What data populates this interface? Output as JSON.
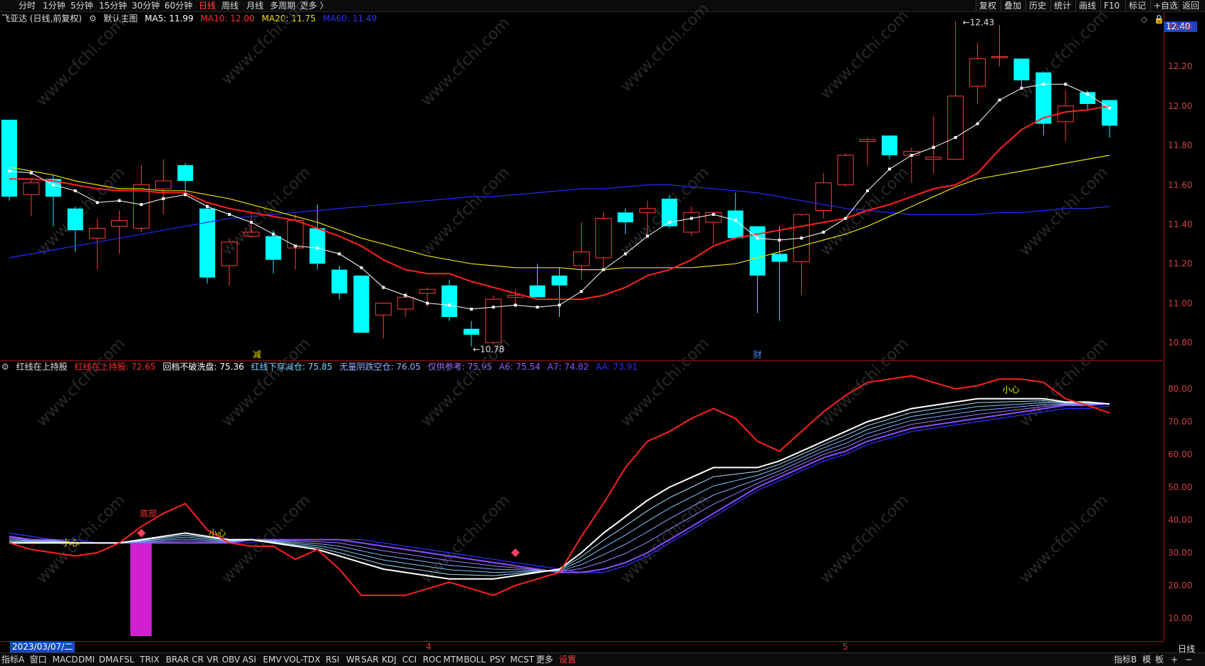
{
  "period_tabs": [
    "分时",
    "1分钟",
    "5分钟",
    "15分钟",
    "30分钟",
    "60分钟",
    "日线",
    "周线",
    "月线",
    "多周期",
    "更多 〉"
  ],
  "active_period": "日线",
  "right_buttons": [
    "复权",
    "叠加",
    "历史",
    "统计",
    "画线",
    "F10",
    "标记",
    "+自选",
    "返回"
  ],
  "main_legend": {
    "title": "飞亚达 (日线,前复权)",
    "template": "默认主图",
    "ma5": "MA5: 11.99",
    "ma10": "MA10: 12.00",
    "ma20": "MA20: 11.75",
    "ma60": "MA60: 11.49"
  },
  "indicator_legend": {
    "name": "红线在上持股",
    "l1": "红线在上持股: 72.65",
    "l2": "回档不破洗盘: 75.36",
    "l3": "红线下穿减仓: 75.85",
    "l4": "无量阴跌空仓: 76.05",
    "l5": "仅供参考: 75.95",
    "l6": "A6: 75.54",
    "l7": "A7: 74.82",
    "l8": "AA: 73.91"
  },
  "price_axis": [
    "12.40",
    "12.20",
    "12.00",
    "11.80",
    "11.60",
    "11.40",
    "11.20",
    "11.00",
    "10.80"
  ],
  "current_price": "12.40",
  "indicator_axis": [
    "80.00",
    "70.00",
    "60.00",
    "50.00",
    "40.00",
    "30.00",
    "20.00",
    "10.00"
  ],
  "annotations": {
    "high": "12.43",
    "low": "10.78",
    "event_jian": "减",
    "event_cai": "财",
    "signal_small1": "小心",
    "signal_bottom": "底部",
    "signal_small2": "小心",
    "signal_small3": "小心"
  },
  "date_axis": {
    "current": "2023/03/07/二",
    "m4": "4",
    "m5": "5"
  },
  "bottom_tabs": [
    "指标A",
    "窗口",
    "MACD",
    "DMI",
    "DMA",
    "FSL",
    "TRIX",
    "BRAR",
    "CR",
    "VR",
    "OBV",
    "ASI",
    "EMV",
    "VOL-TDX",
    "RSI",
    "WR",
    "SAR",
    "KDJ",
    "CCI",
    "ROC",
    "MTM",
    "BOLL",
    "PSY",
    "MCST",
    "更多",
    "设置"
  ],
  "bottom_right": [
    "指标B",
    "模",
    "板",
    "+",
    "−",
    "日线"
  ],
  "watermark": "www.cfchi.com",
  "colors": {
    "up": "#ff3b3b",
    "down": "#00ffff",
    "ma5": "#ffffff",
    "ma10": "#ff2020",
    "ma20": "#e8e000",
    "ma60": "#2828ff",
    "axis": "#b01010"
  },
  "chart_data": {
    "type": "candlestick",
    "candles": [
      {
        "o": 11.93,
        "h": 11.93,
        "l": 11.52,
        "c": 11.54
      },
      {
        "o": 11.55,
        "h": 11.63,
        "l": 11.44,
        "c": 11.61
      },
      {
        "o": 11.63,
        "h": 11.65,
        "l": 11.39,
        "c": 11.54
      },
      {
        "o": 11.48,
        "h": 11.49,
        "l": 11.26,
        "c": 11.37
      },
      {
        "o": 11.33,
        "h": 11.43,
        "l": 11.17,
        "c": 11.38
      },
      {
        "o": 11.39,
        "h": 11.47,
        "l": 11.25,
        "c": 11.42
      },
      {
        "o": 11.38,
        "h": 11.7,
        "l": 11.36,
        "c": 11.6
      },
      {
        "o": 11.58,
        "h": 11.73,
        "l": 11.45,
        "c": 11.62
      },
      {
        "o": 11.7,
        "h": 11.71,
        "l": 11.55,
        "c": 11.62
      },
      {
        "o": 11.48,
        "h": 11.5,
        "l": 11.1,
        "c": 11.13
      },
      {
        "o": 11.19,
        "h": 11.33,
        "l": 11.09,
        "c": 11.31
      },
      {
        "o": 11.34,
        "h": 11.46,
        "l": 11.33,
        "c": 11.36
      },
      {
        "o": 11.34,
        "h": 11.37,
        "l": 11.15,
        "c": 11.22
      },
      {
        "o": 11.28,
        "h": 11.45,
        "l": 11.17,
        "c": 11.42
      },
      {
        "o": 11.38,
        "h": 11.5,
        "l": 11.17,
        "c": 11.2
      },
      {
        "o": 11.17,
        "h": 11.19,
        "l": 11.02,
        "c": 11.05
      },
      {
        "o": 11.14,
        "h": 11.14,
        "l": 10.85,
        "c": 10.85
      },
      {
        "o": 10.94,
        "h": 11.0,
        "l": 10.82,
        "c": 11.0
      },
      {
        "o": 10.97,
        "h": 11.05,
        "l": 10.93,
        "c": 11.03
      },
      {
        "o": 11.05,
        "h": 11.08,
        "l": 10.98,
        "c": 11.07
      },
      {
        "o": 11.09,
        "h": 11.12,
        "l": 10.91,
        "c": 10.93
      },
      {
        "o": 10.87,
        "h": 10.91,
        "l": 10.78,
        "c": 10.84
      },
      {
        "o": 10.8,
        "h": 11.04,
        "l": 10.79,
        "c": 11.02
      },
      {
        "o": 11.03,
        "h": 11.07,
        "l": 10.98,
        "c": 11.04
      },
      {
        "o": 11.09,
        "h": 11.2,
        "l": 11.03,
        "c": 11.03
      },
      {
        "o": 11.14,
        "h": 11.18,
        "l": 10.93,
        "c": 11.09
      },
      {
        "o": 11.19,
        "h": 11.41,
        "l": 11.12,
        "c": 11.26
      },
      {
        "o": 11.23,
        "h": 11.46,
        "l": 11.18,
        "c": 11.43
      },
      {
        "o": 11.46,
        "h": 11.48,
        "l": 11.35,
        "c": 11.41
      },
      {
        "o": 11.46,
        "h": 11.52,
        "l": 11.33,
        "c": 11.48
      },
      {
        "o": 11.53,
        "h": 11.55,
        "l": 11.38,
        "c": 11.39
      },
      {
        "o": 11.36,
        "h": 11.49,
        "l": 11.34,
        "c": 11.46
      },
      {
        "o": 11.41,
        "h": 11.46,
        "l": 11.3,
        "c": 11.46
      },
      {
        "o": 11.47,
        "h": 11.56,
        "l": 11.34,
        "c": 11.33
      },
      {
        "o": 11.39,
        "h": 11.39,
        "l": 10.95,
        "c": 11.14
      },
      {
        "o": 11.25,
        "h": 11.39,
        "l": 10.91,
        "c": 11.21
      },
      {
        "o": 11.21,
        "h": 11.44,
        "l": 11.04,
        "c": 11.45
      },
      {
        "o": 11.47,
        "h": 11.66,
        "l": 11.43,
        "c": 11.61
      },
      {
        "o": 11.6,
        "h": 11.76,
        "l": 11.59,
        "c": 11.75
      },
      {
        "o": 11.82,
        "h": 11.84,
        "l": 11.7,
        "c": 11.83
      },
      {
        "o": 11.85,
        "h": 11.85,
        "l": 11.73,
        "c": 11.75
      },
      {
        "o": 11.75,
        "h": 11.79,
        "l": 11.61,
        "c": 11.77
      },
      {
        "o": 11.73,
        "h": 11.95,
        "l": 11.66,
        "c": 11.74
      },
      {
        "o": 11.73,
        "h": 12.43,
        "l": 11.73,
        "c": 12.05
      },
      {
        "o": 12.1,
        "h": 12.32,
        "l": 12.01,
        "c": 12.24
      },
      {
        "o": 12.25,
        "h": 12.41,
        "l": 12.2,
        "c": 12.25
      },
      {
        "o": 12.24,
        "h": 12.24,
        "l": 12.09,
        "c": 12.13
      },
      {
        "o": 12.17,
        "h": 12.17,
        "l": 11.85,
        "c": 11.91
      },
      {
        "o": 11.92,
        "h": 12.08,
        "l": 11.82,
        "c": 12.0
      },
      {
        "o": 12.07,
        "h": 12.08,
        "l": 11.98,
        "c": 12.01
      },
      {
        "o": 12.03,
        "h": 12.03,
        "l": 11.84,
        "c": 11.9
      }
    ],
    "ma5": [
      11.67,
      11.66,
      11.6,
      11.57,
      11.51,
      11.52,
      11.5,
      11.53,
      11.55,
      11.49,
      11.45,
      11.41,
      11.35,
      11.29,
      11.28,
      11.25,
      11.18,
      11.08,
      11.04,
      11.0,
      10.99,
      10.97,
      10.98,
      10.99,
      10.98,
      10.99,
      11.06,
      11.17,
      11.25,
      11.34,
      11.41,
      11.43,
      11.45,
      11.42,
      11.33,
      11.32,
      11.33,
      11.36,
      11.43,
      11.57,
      11.68,
      11.75,
      11.79,
      11.84,
      11.91,
      12.03,
      12.09,
      12.11,
      12.11,
      12.06,
      11.99
    ],
    "ma10": [
      11.63,
      11.63,
      11.62,
      11.6,
      11.58,
      11.57,
      11.57,
      11.56,
      11.56,
      11.51,
      11.48,
      11.46,
      11.44,
      11.42,
      11.38,
      11.34,
      11.29,
      11.22,
      11.17,
      11.15,
      11.15,
      11.11,
      11.08,
      11.05,
      11.02,
      11.02,
      11.02,
      11.04,
      11.08,
      11.14,
      11.17,
      11.22,
      11.29,
      11.33,
      11.35,
      11.37,
      11.39,
      11.41,
      11.43,
      11.47,
      11.5,
      11.54,
      11.58,
      11.6,
      11.66,
      11.78,
      11.88,
      11.94,
      11.97,
      11.98,
      12.0
    ],
    "ma20": [
      11.69,
      11.67,
      11.65,
      11.62,
      11.6,
      11.58,
      11.58,
      11.57,
      11.57,
      11.55,
      11.53,
      11.5,
      11.47,
      11.44,
      11.41,
      11.37,
      11.33,
      11.3,
      11.27,
      11.24,
      11.22,
      11.2,
      11.19,
      11.18,
      11.18,
      11.18,
      11.17,
      11.17,
      11.18,
      11.18,
      11.18,
      11.18,
      11.19,
      11.2,
      11.23,
      11.26,
      11.29,
      11.32,
      11.35,
      11.39,
      11.44,
      11.49,
      11.54,
      11.59,
      11.63,
      11.65,
      11.67,
      11.69,
      11.71,
      11.73,
      11.75
    ],
    "ma60": [
      11.23,
      11.25,
      11.27,
      11.29,
      11.31,
      11.33,
      11.35,
      11.37,
      11.39,
      11.41,
      11.43,
      11.44,
      11.45,
      11.46,
      11.47,
      11.48,
      11.49,
      11.5,
      11.51,
      11.52,
      11.53,
      11.54,
      11.54,
      11.55,
      11.56,
      11.57,
      11.58,
      11.58,
      11.59,
      11.6,
      11.6,
      11.59,
      11.58,
      11.57,
      11.56,
      11.54,
      11.52,
      11.5,
      11.48,
      11.47,
      11.46,
      11.45,
      11.45,
      11.45,
      11.45,
      11.46,
      11.46,
      11.47,
      11.48,
      11.48,
      11.49
    ],
    "indicator": {
      "red": [
        33,
        31,
        30,
        29,
        30,
        33,
        38,
        42,
        45,
        37,
        33,
        32,
        32,
        28,
        31,
        25,
        17,
        17,
        17,
        19,
        21,
        19,
        17,
        20,
        22,
        24,
        35,
        45,
        56,
        64,
        67,
        71,
        74,
        71,
        64,
        61,
        67,
        73,
        78,
        82,
        83,
        84,
        82,
        80,
        81,
        83,
        83,
        82,
        77,
        75,
        72.65
      ],
      "white": [
        33,
        33,
        33,
        33,
        33,
        33,
        34,
        35,
        36,
        35,
        34,
        34,
        33,
        32,
        31,
        29,
        27,
        25,
        24,
        23,
        22,
        22,
        22,
        23,
        24,
        25,
        30,
        36,
        41,
        46,
        50,
        53,
        56,
        56,
        56,
        58,
        61,
        64,
        67,
        70,
        72,
        74,
        75,
        76,
        77,
        77,
        77,
        77,
        76,
        76,
        75.36
      ],
      "mid": [
        34,
        34,
        33,
        33,
        33,
        33,
        33,
        33,
        34,
        34,
        34,
        34,
        34,
        33,
        33,
        32,
        31,
        30,
        29,
        28,
        27,
        26,
        25,
        25,
        25,
        25,
        27,
        30,
        34,
        38,
        42,
        46,
        49,
        52,
        54,
        56,
        58,
        61,
        64,
        67,
        69,
        71,
        72,
        73,
        74,
        75,
        75,
        76,
        76,
        76,
        75.9
      ],
      "purple": [
        35,
        34,
        34,
        33,
        33,
        33,
        33,
        33,
        33,
        33,
        33,
        34,
        34,
        34,
        34,
        34,
        33,
        32,
        31,
        30,
        29,
        28,
        27,
        26,
        25,
        24,
        24,
        25,
        27,
        30,
        34,
        38,
        42,
        46,
        50,
        53,
        56,
        59,
        61,
        64,
        66,
        68,
        69,
        70,
        71,
        72,
        73,
        74,
        75,
        75,
        75.5
      ],
      "blue": [
        36,
        35,
        34,
        34,
        33,
        33,
        33,
        33,
        33,
        33,
        33,
        33,
        34,
        34,
        34,
        34,
        34,
        33,
        32,
        31,
        30,
        29,
        28,
        27,
        26,
        25,
        24,
        24,
        26,
        29,
        33,
        37,
        41,
        45,
        49,
        52,
        55,
        58,
        60,
        63,
        65,
        67,
        68,
        69,
        70,
        71,
        72,
        73,
        74,
        74,
        74.82
      ]
    }
  }
}
